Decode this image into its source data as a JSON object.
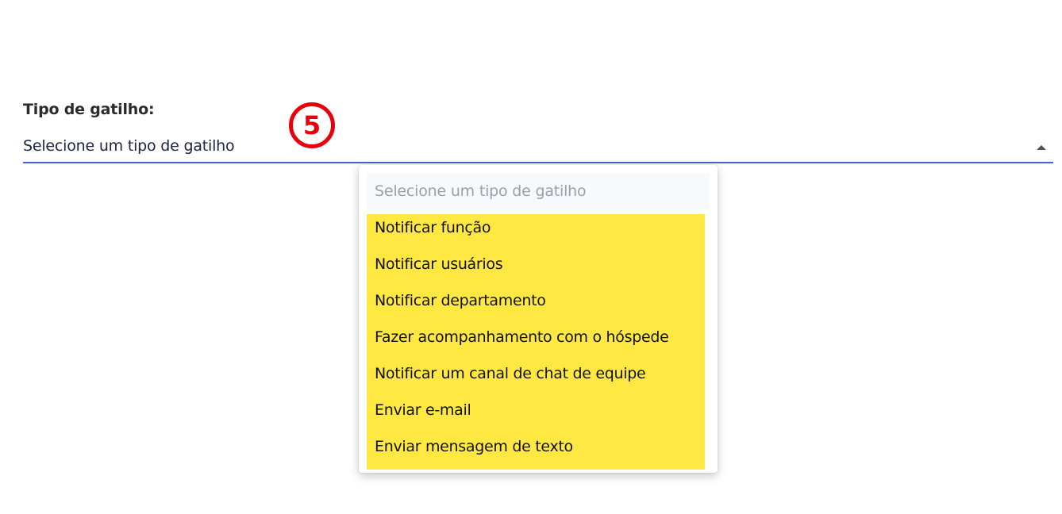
{
  "trigger_field": {
    "label": "Tipo de gatilho:",
    "selected_value": "Selecione um tipo de gatilho",
    "step_badge": "5"
  },
  "dropdown": {
    "placeholder": "Selecione um tipo de gatilho",
    "options": [
      "Notificar função",
      "Notificar usuários",
      "Notificar departamento",
      "Fazer acompanhamento com o hóspede",
      "Notificar um canal de chat de equipe",
      "Enviar e-mail",
      "Enviar mensagem de texto"
    ]
  },
  "colors": {
    "highlight": "#ffe842",
    "badge": "#e8000b",
    "underline": "#3f64d6"
  }
}
